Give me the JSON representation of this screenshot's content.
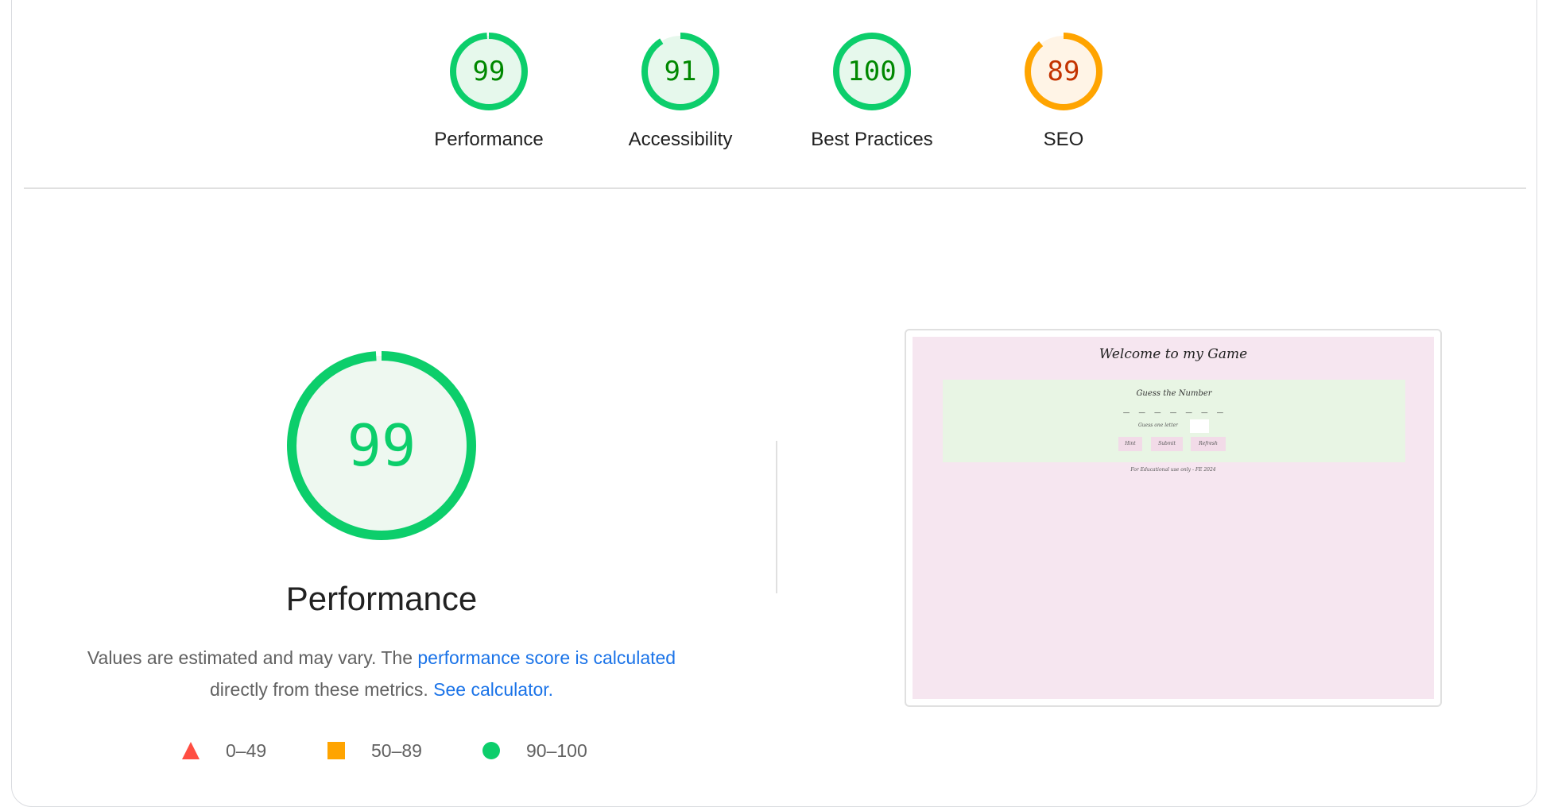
{
  "gauges": [
    {
      "label": "Performance",
      "score": "99",
      "status": "pass"
    },
    {
      "label": "Accessibility",
      "score": "91",
      "status": "pass"
    },
    {
      "label": "Best Practices",
      "score": "100",
      "status": "pass"
    },
    {
      "label": "SEO",
      "score": "89",
      "status": "average"
    }
  ],
  "colors": {
    "pass": "#0cce6b",
    "pass_text": "#008800",
    "pass_fill": "#e6f8ec",
    "average": "#ffa400",
    "average_text": "#c33300",
    "average_fill": "#fff4e6",
    "fail": "#ff4e42",
    "link": "#1a73e8"
  },
  "main": {
    "score": "99",
    "title": "Performance",
    "desc_prefix": "Values are estimated and may vary. The ",
    "desc_link1": "performance score is calculated",
    "desc_middle": "directly from these metrics.",
    "desc_link2": "See calculator."
  },
  "legend": [
    {
      "range": "0–49",
      "shape": "triangle-icon"
    },
    {
      "range": "50–89",
      "shape": "square-icon"
    },
    {
      "range": "90–100",
      "shape": "circle-icon"
    }
  ],
  "thumbnail": {
    "title": "Welcome to my Game",
    "subtitle": "Guess the Number",
    "dashes": "_ _ _ _ _ _ _",
    "guess_label": "Guess one letter",
    "buttons": [
      "Hint",
      "Submit",
      "Refresh"
    ],
    "footer": "For Educational use only - FE 2024"
  }
}
